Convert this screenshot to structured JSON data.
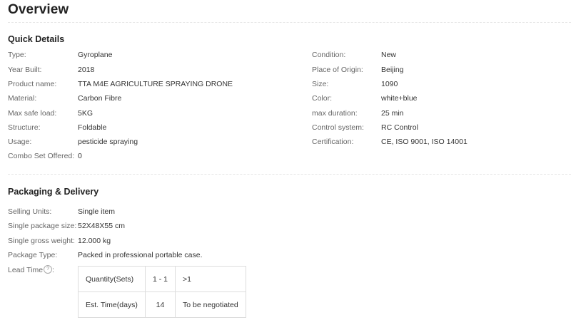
{
  "header": {
    "title": "Overview"
  },
  "quick_details": {
    "title": "Quick Details",
    "left": [
      {
        "label": "Type:",
        "value": "Gyroplane"
      },
      {
        "label": "Year Built:",
        "value": "2018"
      },
      {
        "label": "Product name:",
        "value": "TTA M4E AGRICULTURE SPRAYING DRONE"
      },
      {
        "label": "Material:",
        "value": "Carbon Fibre"
      },
      {
        "label": "Max safe load:",
        "value": "5KG"
      },
      {
        "label": "Structure:",
        "value": "Foldable"
      },
      {
        "label": "Usage:",
        "value": "pesticide spraying"
      },
      {
        "label": "Combo Set Offered:",
        "value": "0"
      }
    ],
    "right": [
      {
        "label": "Condition:",
        "value": "New"
      },
      {
        "label": "Place of Origin:",
        "value": "Beijing"
      },
      {
        "label": "Size:",
        "value": "1090"
      },
      {
        "label": "Color:",
        "value": "white+blue"
      },
      {
        "label": "max duration:",
        "value": "25 min"
      },
      {
        "label": "Control system:",
        "value": "RC Control"
      },
      {
        "label": "Certification:",
        "value": "CE, ISO 9001, ISO 14001"
      }
    ]
  },
  "packaging": {
    "title": "Packaging & Delivery",
    "rows": [
      {
        "label": "Selling Units:",
        "value": "Single item"
      },
      {
        "label": "Single package size:",
        "value": "52X48X55 cm"
      },
      {
        "label": "Single gross weight:",
        "value": "12.000 kg"
      },
      {
        "label": "Package Type:",
        "value": "Packed in professional portable case."
      }
    ],
    "lead_time": {
      "label": "Lead Time",
      "help_icon": "question-circle-icon",
      "help_glyph": "?",
      "colon": ":",
      "table": [
        [
          "Quantity(Sets)",
          "1 - 1",
          ">1"
        ],
        [
          "Est. Time(days)",
          "14",
          "To be negotiated"
        ]
      ]
    }
  }
}
